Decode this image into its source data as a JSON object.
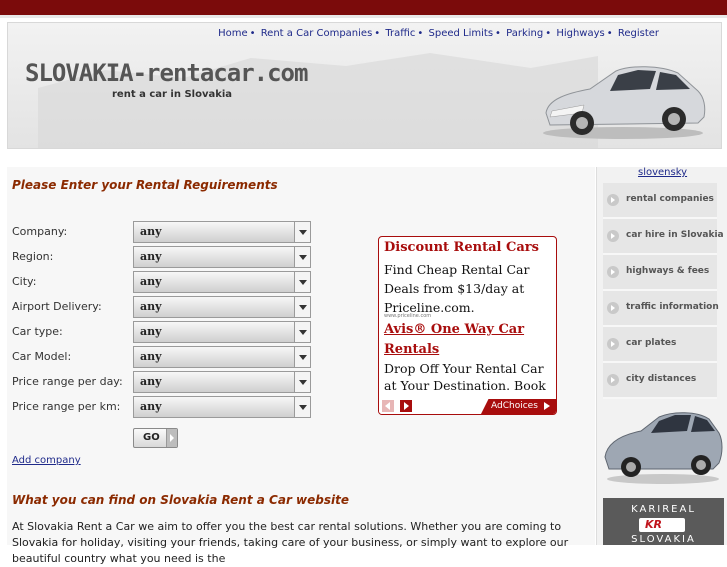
{
  "header": {
    "nav": [
      "Home",
      "Rent a Car Companies",
      "Traffic",
      "Speed Limits",
      "Parking",
      "Highways",
      "Register"
    ],
    "logo": "SLOVAKIA-rentacar.com",
    "tagline": "rent a car in Slovakia"
  },
  "form": {
    "title": "Please Enter your Rental Reguirements",
    "fields": [
      {
        "label": "Company:",
        "value": "any"
      },
      {
        "label": "Region:",
        "value": "any"
      },
      {
        "label": "City:",
        "value": "any"
      },
      {
        "label": "Airport Delivery:",
        "value": "any"
      },
      {
        "label": "Car type:",
        "value": "any"
      },
      {
        "label": "Car Model:",
        "value": "any"
      },
      {
        "label": "Price range per day:",
        "value": "any"
      },
      {
        "label": "Price range per km:",
        "value": "any"
      }
    ],
    "go_label": "GO",
    "add_company": "Add company"
  },
  "content": {
    "find_title": "What you can find on Slovakia Rent a Car website",
    "intro": "At Slovakia Rent a Car we aim to offer you the best car rental solutions. Whether you are coming to Slovakia for holiday, visiting your friends, taking care of your business, or simply want to explore our beautiful country what you need is the"
  },
  "ad": {
    "title1": "Discount Rental Cars",
    "body1": "Find Cheap Rental Car Deals from $13/day at Priceline.com.",
    "url1": "www.priceline.com",
    "title2": "Avis® One Way Car Rentals",
    "body2": "Drop Off Your Rental Car at Your Destination. Book",
    "choices": "AdChoices",
    "accent": "#a80d0d"
  },
  "sidebar": {
    "language": "slovensky",
    "items": [
      "rental companies",
      "car hire in Slovakia",
      "highways & fees",
      "traffic information",
      "car plates",
      "city distances"
    ],
    "banner_top": "KARIREAL",
    "banner_logo": "KR",
    "banner_bottom": "SLOVAKIA"
  },
  "colors": {
    "topbar": "#7b0b0b",
    "heading": "#8b2a00",
    "link": "#1f2a8a"
  }
}
